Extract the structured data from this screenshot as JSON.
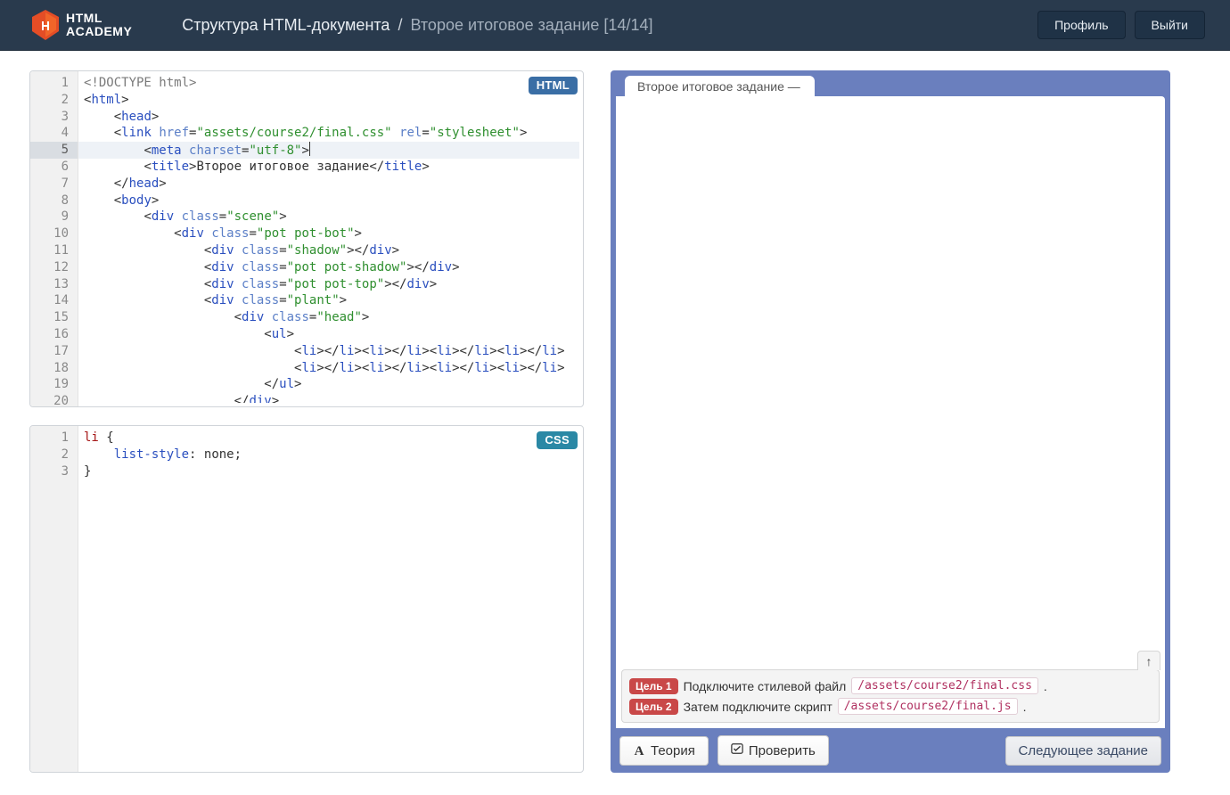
{
  "header": {
    "logo_line1": "HTML",
    "logo_line2": "ACADEMY",
    "breadcrumb_course": "Структура HTML-документа",
    "breadcrumb_sep": "/",
    "breadcrumb_task": "Второе итоговое задание [14/14]",
    "btn_profile": "Профиль",
    "btn_logout": "Выйти"
  },
  "editors": {
    "html_badge": "HTML",
    "css_badge": "CSS",
    "active_line": 5,
    "html_lines_count": 20,
    "css_lines_count": 3,
    "html_code": [
      {
        "indent": 0,
        "tokens": [
          [
            "decl",
            "<!DOCTYPE html>"
          ]
        ]
      },
      {
        "indent": 0,
        "tokens": [
          [
            "pun",
            "<"
          ],
          [
            "tag",
            "html"
          ],
          [
            "pun",
            ">"
          ]
        ]
      },
      {
        "indent": 1,
        "tokens": [
          [
            "pun",
            "<"
          ],
          [
            "tag",
            "head"
          ],
          [
            "pun",
            ">"
          ]
        ]
      },
      {
        "indent": 1,
        "tokens": [
          [
            "pun",
            "<"
          ],
          [
            "tag",
            "link"
          ],
          [
            "txt",
            " "
          ],
          [
            "attr",
            "href"
          ],
          [
            "pun",
            "="
          ],
          [
            "str",
            "\"assets/course2/final.css\""
          ],
          [
            "txt",
            " "
          ],
          [
            "attr",
            "rel"
          ],
          [
            "pun",
            "="
          ],
          [
            "str",
            "\"stylesheet\""
          ],
          [
            "pun",
            ">"
          ]
        ]
      },
      {
        "indent": 2,
        "tokens": [
          [
            "pun",
            "<"
          ],
          [
            "tag",
            "meta"
          ],
          [
            "txt",
            " "
          ],
          [
            "attr",
            "charset"
          ],
          [
            "pun",
            "="
          ],
          [
            "str",
            "\"utf-8\""
          ],
          [
            "pun",
            ">"
          ],
          [
            "cursor",
            ""
          ]
        ]
      },
      {
        "indent": 2,
        "tokens": [
          [
            "pun",
            "<"
          ],
          [
            "tag",
            "title"
          ],
          [
            "pun",
            ">"
          ],
          [
            "txt",
            "Второе итоговое задание"
          ],
          [
            "pun",
            "</"
          ],
          [
            "tag",
            "title"
          ],
          [
            "pun",
            ">"
          ]
        ]
      },
      {
        "indent": 1,
        "tokens": [
          [
            "pun",
            "</"
          ],
          [
            "tag",
            "head"
          ],
          [
            "pun",
            ">"
          ]
        ]
      },
      {
        "indent": 1,
        "tokens": [
          [
            "pun",
            "<"
          ],
          [
            "tag",
            "body"
          ],
          [
            "pun",
            ">"
          ]
        ]
      },
      {
        "indent": 2,
        "tokens": [
          [
            "pun",
            "<"
          ],
          [
            "tag",
            "div"
          ],
          [
            "txt",
            " "
          ],
          [
            "attr",
            "class"
          ],
          [
            "pun",
            "="
          ],
          [
            "str",
            "\"scene\""
          ],
          [
            "pun",
            ">"
          ]
        ]
      },
      {
        "indent": 3,
        "tokens": [
          [
            "pun",
            "<"
          ],
          [
            "tag",
            "div"
          ],
          [
            "txt",
            " "
          ],
          [
            "attr",
            "class"
          ],
          [
            "pun",
            "="
          ],
          [
            "str",
            "\"pot pot-bot\""
          ],
          [
            "pun",
            ">"
          ]
        ]
      },
      {
        "indent": 4,
        "tokens": [
          [
            "pun",
            "<"
          ],
          [
            "tag",
            "div"
          ],
          [
            "txt",
            " "
          ],
          [
            "attr",
            "class"
          ],
          [
            "pun",
            "="
          ],
          [
            "str",
            "\"shadow\""
          ],
          [
            "pun",
            "></"
          ],
          [
            "tag",
            "div"
          ],
          [
            "pun",
            ">"
          ]
        ]
      },
      {
        "indent": 4,
        "tokens": [
          [
            "pun",
            "<"
          ],
          [
            "tag",
            "div"
          ],
          [
            "txt",
            " "
          ],
          [
            "attr",
            "class"
          ],
          [
            "pun",
            "="
          ],
          [
            "str",
            "\"pot pot-shadow\""
          ],
          [
            "pun",
            "></"
          ],
          [
            "tag",
            "div"
          ],
          [
            "pun",
            ">"
          ]
        ]
      },
      {
        "indent": 4,
        "tokens": [
          [
            "pun",
            "<"
          ],
          [
            "tag",
            "div"
          ],
          [
            "txt",
            " "
          ],
          [
            "attr",
            "class"
          ],
          [
            "pun",
            "="
          ],
          [
            "str",
            "\"pot pot-top\""
          ],
          [
            "pun",
            "></"
          ],
          [
            "tag",
            "div"
          ],
          [
            "pun",
            ">"
          ]
        ]
      },
      {
        "indent": 4,
        "tokens": [
          [
            "pun",
            "<"
          ],
          [
            "tag",
            "div"
          ],
          [
            "txt",
            " "
          ],
          [
            "attr",
            "class"
          ],
          [
            "pun",
            "="
          ],
          [
            "str",
            "\"plant\""
          ],
          [
            "pun",
            ">"
          ]
        ]
      },
      {
        "indent": 5,
        "tokens": [
          [
            "pun",
            "<"
          ],
          [
            "tag",
            "div"
          ],
          [
            "txt",
            " "
          ],
          [
            "attr",
            "class"
          ],
          [
            "pun",
            "="
          ],
          [
            "str",
            "\"head\""
          ],
          [
            "pun",
            ">"
          ]
        ]
      },
      {
        "indent": 6,
        "tokens": [
          [
            "pun",
            "<"
          ],
          [
            "tag",
            "ul"
          ],
          [
            "pun",
            ">"
          ]
        ]
      },
      {
        "indent": 7,
        "tokens": [
          [
            "pun",
            "<"
          ],
          [
            "tag",
            "li"
          ],
          [
            "pun",
            "></"
          ],
          [
            "tag",
            "li"
          ],
          [
            "pun",
            "><"
          ],
          [
            "tag",
            "li"
          ],
          [
            "pun",
            "></"
          ],
          [
            "tag",
            "li"
          ],
          [
            "pun",
            "><"
          ],
          [
            "tag",
            "li"
          ],
          [
            "pun",
            "></"
          ],
          [
            "tag",
            "li"
          ],
          [
            "pun",
            "><"
          ],
          [
            "tag",
            "li"
          ],
          [
            "pun",
            "></"
          ],
          [
            "tag",
            "li"
          ],
          [
            "pun",
            ">"
          ]
        ]
      },
      {
        "indent": 7,
        "tokens": [
          [
            "pun",
            "<"
          ],
          [
            "tag",
            "li"
          ],
          [
            "pun",
            "></"
          ],
          [
            "tag",
            "li"
          ],
          [
            "pun",
            "><"
          ],
          [
            "tag",
            "li"
          ],
          [
            "pun",
            "></"
          ],
          [
            "tag",
            "li"
          ],
          [
            "pun",
            "><"
          ],
          [
            "tag",
            "li"
          ],
          [
            "pun",
            "></"
          ],
          [
            "tag",
            "li"
          ],
          [
            "pun",
            "><"
          ],
          [
            "tag",
            "li"
          ],
          [
            "pun",
            "></"
          ],
          [
            "tag",
            "li"
          ],
          [
            "pun",
            ">"
          ]
        ]
      },
      {
        "indent": 6,
        "tokens": [
          [
            "pun",
            "</"
          ],
          [
            "tag",
            "ul"
          ],
          [
            "pun",
            ">"
          ]
        ]
      },
      {
        "indent": 5,
        "tokens": [
          [
            "pun",
            "</"
          ],
          [
            "tag",
            "div"
          ],
          [
            "pun",
            ">"
          ]
        ]
      }
    ],
    "css_code": [
      {
        "indent": 0,
        "tokens": [
          [
            "sel",
            "li"
          ],
          [
            "txt",
            " "
          ],
          [
            "pun",
            "{"
          ]
        ]
      },
      {
        "indent": 1,
        "tokens": [
          [
            "prop",
            "list-style"
          ],
          [
            "pun",
            ":"
          ],
          [
            "txt",
            " "
          ],
          [
            "val",
            "none"
          ],
          [
            "pun",
            ";"
          ]
        ]
      },
      {
        "indent": 0,
        "tokens": [
          [
            "pun",
            "}"
          ]
        ]
      }
    ]
  },
  "preview": {
    "tab_title": "Второе итоговое задание —",
    "goal1_badge": "Цель 1",
    "goal1_text": "Подключите стилевой файл",
    "goal1_path": "/assets/course2/final.css",
    "goal2_badge": "Цель 2",
    "goal2_text": "Затем подключите скрипт",
    "goal2_path": "/assets/course2/final.js",
    "period": ".",
    "btn_theory": "Теория",
    "btn_check": "Проверить",
    "btn_next": "Следующее задание",
    "arrow_up": "↑"
  }
}
